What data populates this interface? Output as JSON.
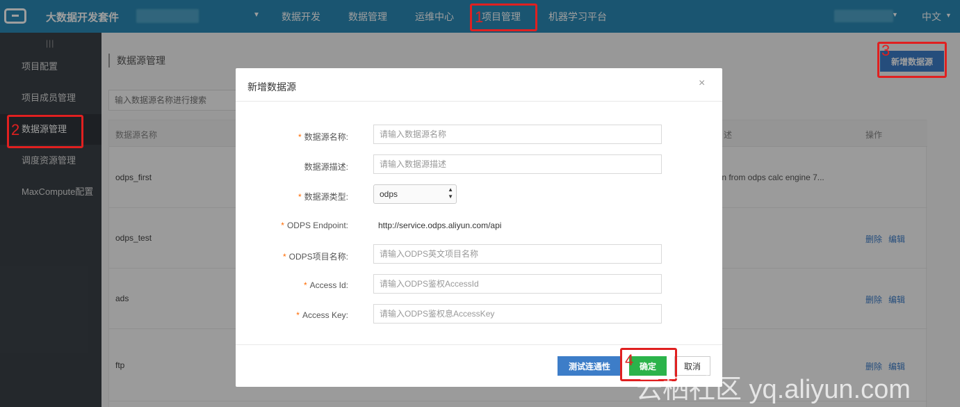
{
  "topbar": {
    "brand": "大数据开发套件",
    "nav": [
      "数据开发",
      "数据管理",
      "运维中心",
      "项目管理",
      "机器学习平台"
    ],
    "lang": "中文"
  },
  "sidebar": {
    "items": [
      "项目配置",
      "项目成员管理",
      "数据源管理",
      "调度资源管理",
      "MaxCompute配置"
    ]
  },
  "main": {
    "title": "数据源管理",
    "search_placeholder": "输入数据源名称进行搜索",
    "add_button": "新增数据源",
    "columns": {
      "name": "数据源名称",
      "desc": "述",
      "ops": "操作"
    },
    "rows": [
      {
        "name": "odps_first",
        "desc": "ion from odps calc engine 7..."
      },
      {
        "name": "odps_test",
        "delete": "删除",
        "edit": "编辑"
      },
      {
        "name": "ads",
        "delete": "删除",
        "edit": "编辑"
      },
      {
        "name": "ftp",
        "delete": "删除",
        "edit": "编辑"
      }
    ]
  },
  "modal": {
    "title": "新增数据源",
    "close": "×",
    "fields": {
      "name": {
        "label": "数据源名称:",
        "placeholder": "请输入数据源名称"
      },
      "desc": {
        "label": "数据源描述:",
        "placeholder": "请输入数据源描述"
      },
      "type": {
        "label": "数据源类型:",
        "value": "odps"
      },
      "endpoint": {
        "label": "ODPS Endpoint:",
        "value": "http://service.odps.aliyun.com/api"
      },
      "project": {
        "label": "ODPS项目名称:",
        "placeholder": "请输入ODPS英文项目名称"
      },
      "access_id": {
        "label": "Access Id:",
        "placeholder": "请输入ODPS鉴权AccessId"
      },
      "access_key": {
        "label": "Access Key:",
        "placeholder": "请输入ODPS鉴权息AccessKey"
      }
    },
    "required_mark": "*",
    "buttons": {
      "test": "测试连通性",
      "ok": "确定",
      "cancel": "取消"
    }
  },
  "annotations": [
    "1",
    "2",
    "3",
    "4"
  ],
  "watermark": "云栖社区 yq.aliyun.com",
  "colors": {
    "topbar": "#2b8ab6",
    "sidebar": "#3b4248",
    "primary": "#3d7dc8",
    "success": "#2bb34a",
    "required": "#ff6a00",
    "annotation": "#e02020"
  }
}
